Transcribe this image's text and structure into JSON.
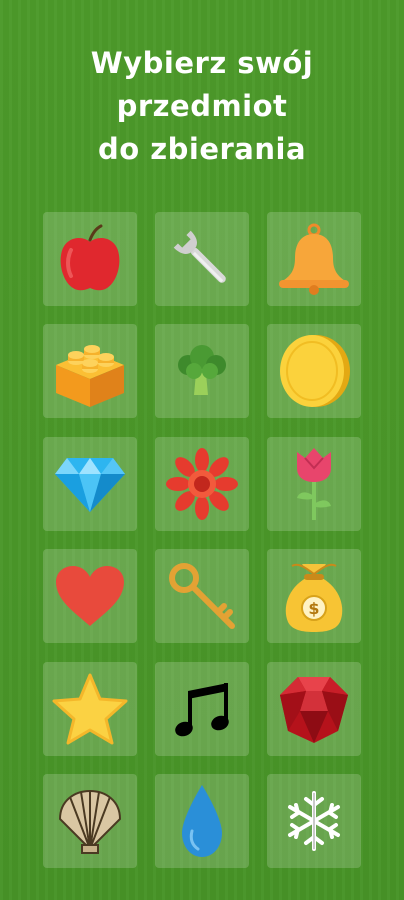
{
  "title": {
    "line1": "Wybierz swój",
    "line2": "przedmiot",
    "line3": "do zbierania"
  },
  "items": [
    {
      "icon": "apple-icon"
    },
    {
      "icon": "wrench-icon"
    },
    {
      "icon": "bell-icon"
    },
    {
      "icon": "lego-brick-icon"
    },
    {
      "icon": "broccoli-icon"
    },
    {
      "icon": "coin-icon"
    },
    {
      "icon": "diamond-icon"
    },
    {
      "icon": "flower-icon"
    },
    {
      "icon": "rose-icon"
    },
    {
      "icon": "heart-icon"
    },
    {
      "icon": "key-icon"
    },
    {
      "icon": "money-bag-icon"
    },
    {
      "icon": "star-icon"
    },
    {
      "icon": "music-note-icon"
    },
    {
      "icon": "ruby-icon"
    },
    {
      "icon": "seashell-icon"
    },
    {
      "icon": "water-drop-icon"
    },
    {
      "icon": "snowflake-icon"
    }
  ],
  "colors": {
    "background": "#4a9729",
    "tile": "#6fb151",
    "title_text": "#ffffff"
  }
}
